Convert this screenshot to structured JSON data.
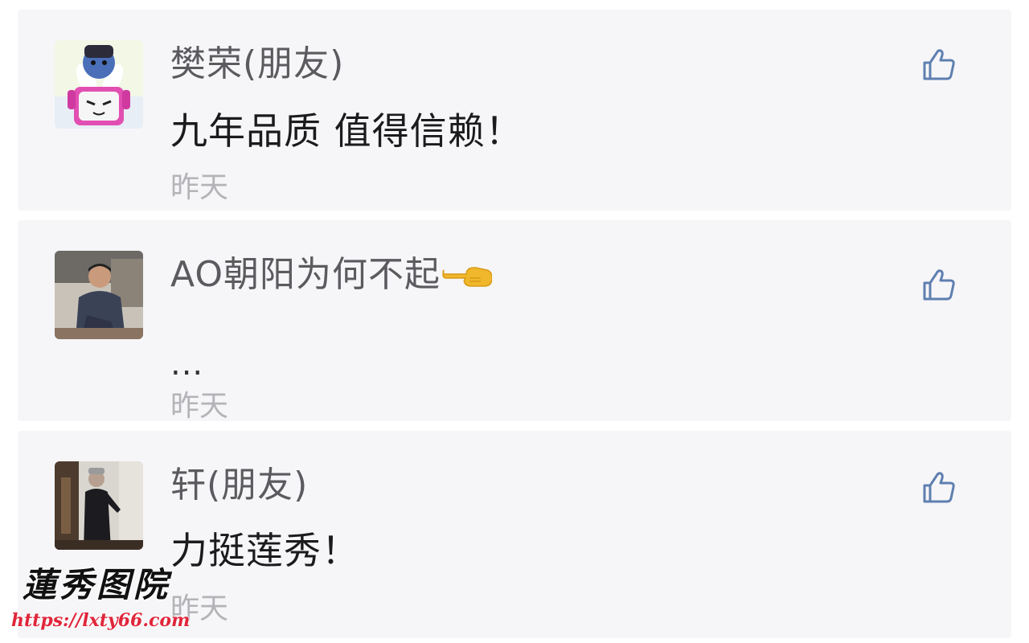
{
  "comments": [
    {
      "name": "樊荣(朋友)",
      "text": "九年品质 值得信赖！",
      "time": "昨天",
      "avatar": "cartoon-bunny-avatar",
      "like_icon": "thumbs-up-icon"
    },
    {
      "name": "AO朝阳为何不起",
      "name_emoji": "pointing-left-hand-emoji",
      "text": "...",
      "time": "昨天",
      "avatar": "man-photo-avatar",
      "like_icon": "thumbs-up-icon"
    },
    {
      "name": "轩(朋友)",
      "text": "力挺莲秀！",
      "time": "昨天",
      "avatar": "man-street-photo-avatar",
      "like_icon": "thumbs-up-icon"
    }
  ],
  "watermark": {
    "title": "蓮秀图院",
    "url": "https://lxty66.com"
  },
  "colors": {
    "card_background": "#f6f6f8",
    "name": "#5b5b5f",
    "comment_text": "#1b1b1d",
    "time": "#b4b4b8",
    "like_icon": "#5f7fb0",
    "watermark_url": "#e0263a"
  }
}
